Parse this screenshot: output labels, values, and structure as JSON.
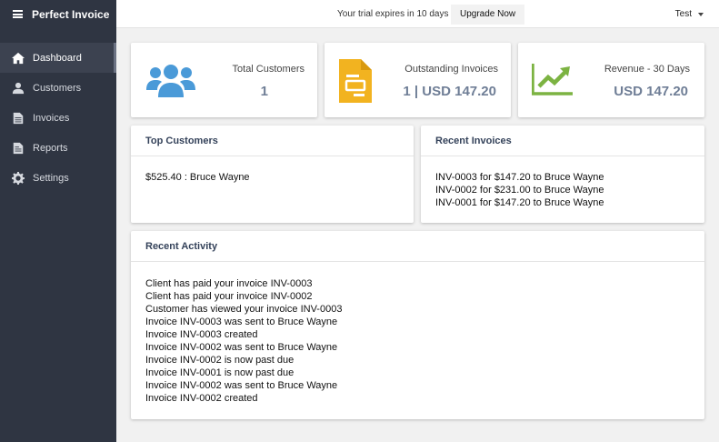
{
  "app": {
    "title": "Perfect Invoice"
  },
  "sidebar": {
    "items": [
      {
        "label": "Dashboard",
        "icon": "home-icon",
        "active": true
      },
      {
        "label": "Customers",
        "icon": "user-icon"
      },
      {
        "label": "Invoices",
        "icon": "invoice-icon"
      },
      {
        "label": "Reports",
        "icon": "report-icon"
      },
      {
        "label": "Settings",
        "icon": "gear-icon"
      }
    ]
  },
  "topbar": {
    "trial_text": "Your trial expires in 10 days",
    "upgrade_label": "Upgrade Now",
    "user_name": "Test"
  },
  "stats": {
    "customers": {
      "label": "Total Customers",
      "value": "1",
      "icon": "users-icon",
      "color": "#4a9ad8"
    },
    "outstanding": {
      "label": "Outstanding Invoices",
      "value": "1 | USD 147.20",
      "icon": "document-icon",
      "color": "#f2b320"
    },
    "revenue": {
      "label": "Revenue - 30 Days",
      "value": "USD 147.20",
      "icon": "trend-chart-icon",
      "color": "#7cb342"
    }
  },
  "top_customers": {
    "title": "Top Customers",
    "items": [
      "$525.40 : Bruce Wayne"
    ]
  },
  "recent_invoices": {
    "title": "Recent Invoices",
    "items": [
      "INV-0003 for $147.20 to Bruce Wayne",
      "INV-0002 for $231.00 to Bruce Wayne",
      "INV-0001 for $147.20 to Bruce Wayne"
    ]
  },
  "recent_activity": {
    "title": "Recent Activity",
    "items": [
      "Client has paid your invoice INV-0003",
      "Client has paid your invoice INV-0002",
      "Customer has viewed your invoice INV-0003",
      "Invoice INV-0003 was sent to Bruce Wayne",
      "Invoice INV-0003 created",
      "Invoice INV-0002 was sent to Bruce Wayne",
      "Invoice INV-0002 is now past due",
      "Invoice INV-0001 is now past due",
      "Invoice INV-0002 was sent to Bruce Wayne",
      "Invoice INV-0002 created"
    ]
  }
}
